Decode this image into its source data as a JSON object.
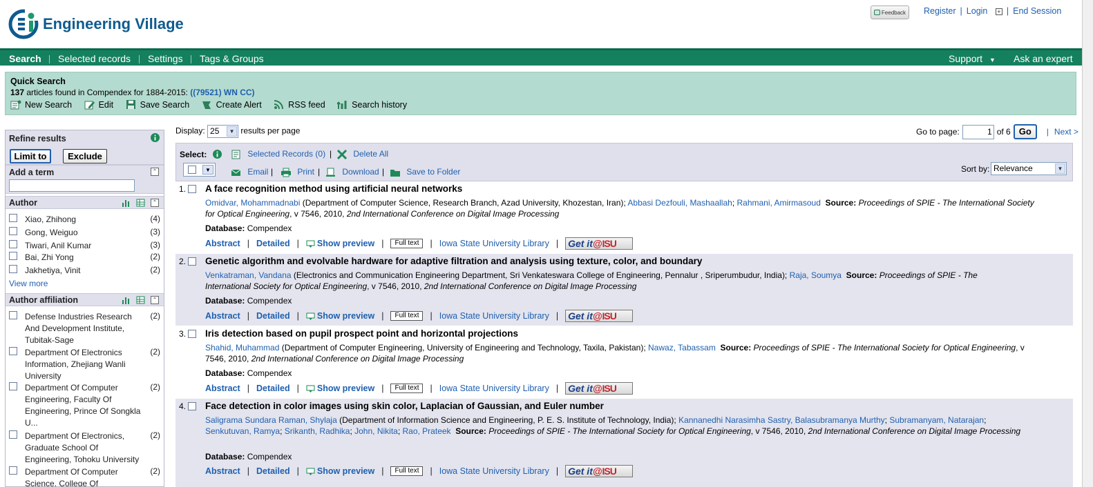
{
  "header": {
    "brand": "Engineering Village",
    "feedback": "Feedback",
    "register": "Register",
    "login": "Login",
    "end_session": "End Session"
  },
  "nav": {
    "search": "Search",
    "selected_records": "Selected records",
    "settings": "Settings",
    "tags_groups": "Tags & Groups",
    "support": "Support",
    "ask_expert": "Ask an expert"
  },
  "quick_search": {
    "title": "Quick Search",
    "count": "137",
    "found_text": "articles found in Compendex for 1884-2015:",
    "query": "((79521) WN CC)",
    "actions": {
      "new_search": "New Search",
      "edit": "Edit",
      "save_search": "Save Search",
      "create_alert": "Create Alert",
      "rss": "RSS feed",
      "history": "Search history"
    }
  },
  "sidebar": {
    "refine": "Refine results",
    "limit_to": "Limit to",
    "exclude": "Exclude",
    "add_term": "Add a term",
    "author_head": "Author",
    "authors": [
      {
        "name": "Xiao, Zhihong",
        "count": "(4)"
      },
      {
        "name": "Gong, Weiguo",
        "count": "(3)"
      },
      {
        "name": "Tiwari, Anil Kumar",
        "count": "(3)"
      },
      {
        "name": "Bai, Zhi Yong",
        "count": "(2)"
      },
      {
        "name": "Jakhetiya, Vinit",
        "count": "(2)"
      }
    ],
    "view_more": "View more",
    "affiliation_head": "Author affiliation",
    "affiliations": [
      {
        "name": "Defense Industries Research And Development Institute, Tubitak-Sage",
        "count": "(2)"
      },
      {
        "name": "Department Of Electronics Information, Zhejiang Wanli University",
        "count": "(2)"
      },
      {
        "name": "Department Of Computer Engineering, Faculty Of Engineering, Prince Of Songkla U...",
        "count": "(2)"
      },
      {
        "name": "Department Of Electronics, Graduate School Of Engineering, Tohoku University",
        "count": "(2)"
      },
      {
        "name": "Department Of Computer Science, College Of Information",
        "count": "(2)"
      }
    ]
  },
  "results_bar": {
    "display_label": "Display:",
    "display_value": "25",
    "per_page": "results per page",
    "goto_label": "Go to page:",
    "page_value": "1",
    "of_pages": "of 6",
    "go": "Go",
    "next": "Next >"
  },
  "toolbar": {
    "select": "Select:",
    "selected_records": "Selected Records (0)",
    "delete_all": "Delete All",
    "email": "Email",
    "print": "Print",
    "download": "Download",
    "save_folder": "Save to Folder",
    "sort_by": "Sort by:",
    "sort_value": "Relevance"
  },
  "result_links": {
    "abstract": "Abstract",
    "detailed": "Detailed",
    "show_preview": "Show preview",
    "full_text": "Full text",
    "library": "Iowa State University Library",
    "getit_prefix": "Get it",
    "getit_at": "@",
    "getit_isu": "ISU",
    "database_label": "Database:",
    "database_value": "Compendex",
    "source_label": "Source:"
  },
  "results": [
    {
      "num": "1.",
      "title": "A face recognition method using artificial neural networks",
      "a1": "Omidvar, Mohammadnabi",
      "aff1": " (Department of Computer Science, Research Branch, Azad University, Khozestan, Iran); ",
      "a2": "Abbasi Dezfouli, Mashaallah",
      "a3": "Rahmani, Amirmasoud",
      "src": "Proceedings of SPIE - The International Society for Optical Engineering",
      "vol": ", v 7546, 2010, ",
      "conf": "2nd International Conference on Digital Image Processing"
    },
    {
      "num": "2.",
      "title": "Genetic algorithm and evolvable hardware for adaptive filtration and analysis using texture, color, and boundary",
      "a1": "Venkatraman, Vandana",
      "aff1": " (Electronics and Communication Engineering Department, Sri Venkateswara College of Engineering, Pennalur , Sriperumbudur, India); ",
      "a2": "Raja, Soumya",
      "src": "Proceedings of SPIE - The International Society for Optical Engineering",
      "vol": ", v 7546, 2010, ",
      "conf": "2nd International Conference on Digital Image Processing"
    },
    {
      "num": "3.",
      "title": "Iris detection based on pupil prospect point and horizontal projections",
      "a1": "Shahid, Muhammad",
      "aff1": " (Department of Computer Engineering, University of Engineering and Technology, Taxila, Pakistan); ",
      "a2": "Nawaz, Tabassam",
      "src": "Proceedings of SPIE - The International Society for Optical Engineering",
      "vol": ", v 7546, 2010, ",
      "conf": "2nd International Conference on Digital Image Processing"
    },
    {
      "num": "4.",
      "title": "Face detection in color images using skin color, Laplacian of Gaussian, and Euler number",
      "a1": "Saligrama Sundara Raman, Shylaja",
      "aff1": " (Department of Information Science and Engineering, P. E. S. Institute of Technology, India); ",
      "a2": "Kannanedhi Narasimha Sastry, Balasubramanya Murthy",
      "a3": "Subramanyam, Natarajan",
      "a4": "Senkutuvan, Ramya",
      "a5": "Srikanth, Radhika",
      "a6": "John, Nikita",
      "a7": "Rao, Prateek",
      "src": "Proceedings of SPIE - The International Society for Optical Engineering",
      "vol": ", v 7546, 2010, ",
      "conf": "2nd International Conference on Digital Image Processing"
    }
  ]
}
